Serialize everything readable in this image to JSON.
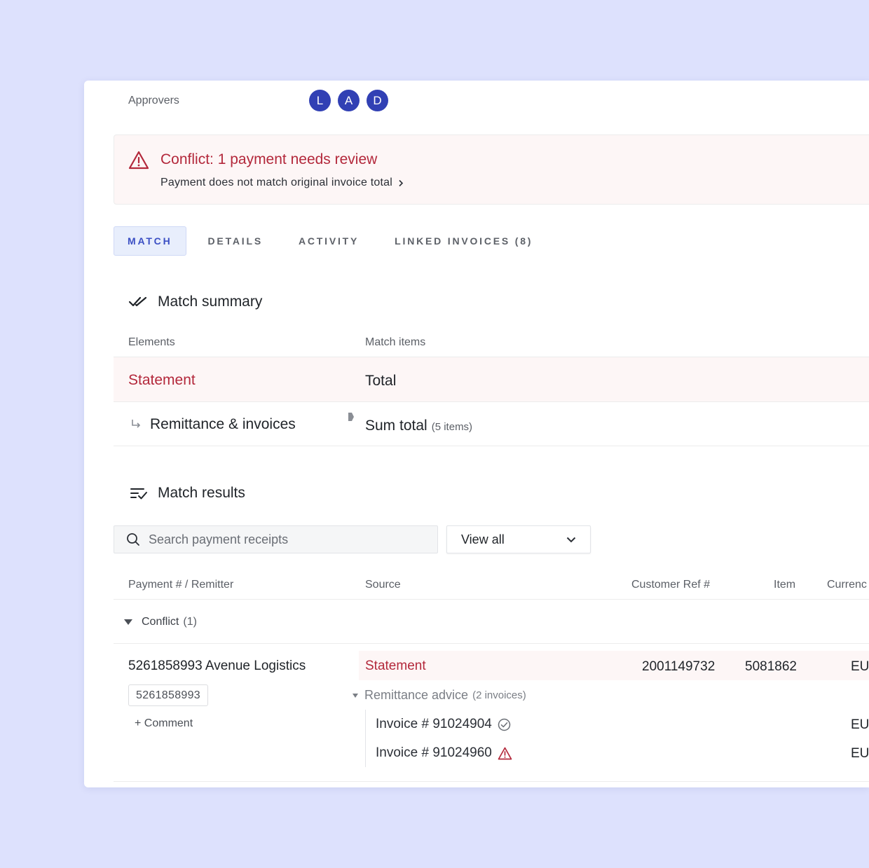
{
  "approvers": {
    "label": "Approvers",
    "avatars": [
      "L",
      "A",
      "D"
    ]
  },
  "conflict": {
    "title": "Conflict: 1 payment needs review",
    "subtitle": "Payment does not match original invoice total"
  },
  "tabs": [
    {
      "label": "MATCH",
      "active": true
    },
    {
      "label": "DETAILS",
      "active": false
    },
    {
      "label": "ACTIVITY",
      "active": false
    },
    {
      "label": "LINKED INVOICES (8)",
      "active": false
    }
  ],
  "match_summary": {
    "title": "Match summary",
    "columns": {
      "elements": "Elements",
      "match_items": "Match items"
    },
    "rows": [
      {
        "element": "Statement",
        "match": "Total",
        "extra": ""
      },
      {
        "element": "Remittance & invoices",
        "match": "Sum total",
        "extra": "(5 items)"
      }
    ]
  },
  "match_results": {
    "title": "Match results",
    "search_placeholder": "Search payment receipts",
    "filter": {
      "selected": "View all"
    },
    "columns": {
      "payment": "Payment # / Remitter",
      "source": "Source",
      "customer_ref": "Customer Ref #",
      "item": "Item",
      "currency": "Currenc"
    },
    "group": {
      "label": "Conflict",
      "count": "(1)"
    },
    "entry": {
      "title": "5261858993 Avenue Logistics",
      "pill": "5261858993",
      "comment": "+ Comment",
      "source": "Statement",
      "customer_ref": "2001149732",
      "item": "5081862",
      "currency": "EU",
      "remittance": {
        "label": "Remittance advice",
        "count": "(2 invoices)"
      },
      "invoices": [
        {
          "label": "Invoice # 91024904",
          "status": "check-circle-icon",
          "currency": "EU"
        },
        {
          "label": "Invoice # 91024960",
          "status": "warning-icon",
          "currency": "EU"
        }
      ]
    }
  },
  "colors": {
    "background": "#dde1fd",
    "accent": "#3b4fc4",
    "avatar": "#3140b4",
    "error": "#b3283b",
    "error_bg": "#fdf6f6"
  }
}
